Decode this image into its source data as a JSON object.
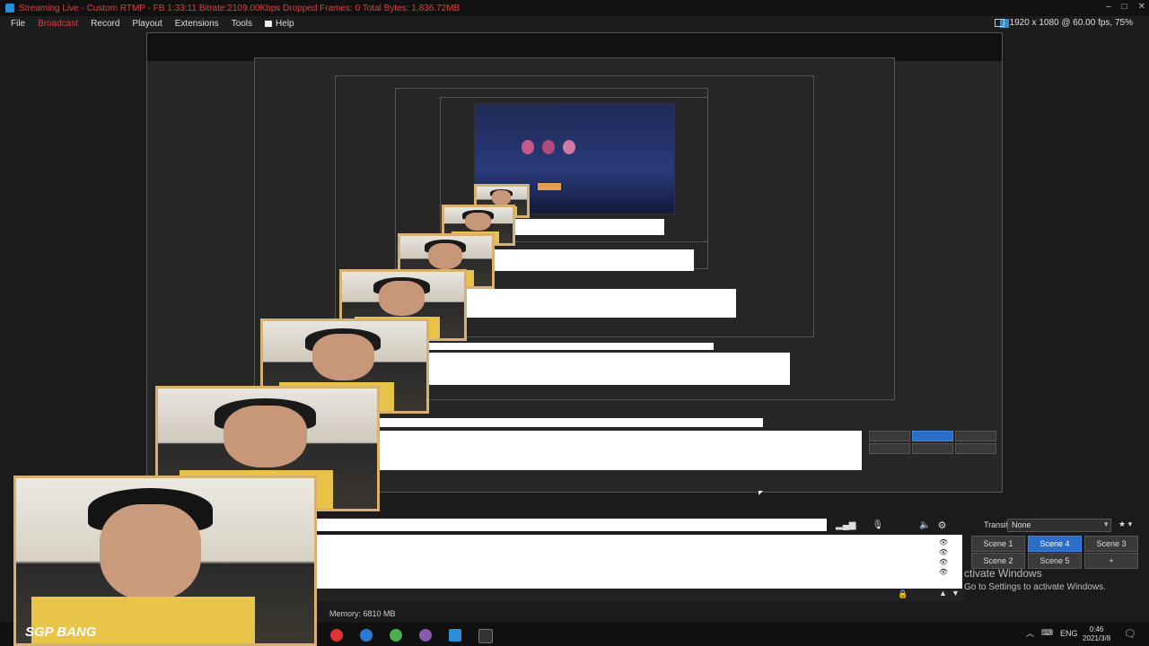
{
  "window": {
    "title": "Streaming Live - Custom RTMP - FB 1:33:11  Bitrate:2109.00Kbps  Dropped Frames: 0  Total Bytes: 1,836.72MB",
    "resolution": "1920 x 1080 @ 60.00 fps, 75%"
  },
  "menu": {
    "file": "File",
    "broadcast": "Broadcast",
    "record": "Record",
    "playout": "Playout",
    "extensions": "Extensions",
    "tools": "Tools",
    "help": "Help"
  },
  "transition": {
    "label": "Transition",
    "value": "None"
  },
  "scenes": [
    {
      "label": "Scene 1",
      "active": false
    },
    {
      "label": "Scene 4",
      "active": true
    },
    {
      "label": "Scene 3",
      "active": false
    },
    {
      "label": "Scene 2",
      "active": false
    },
    {
      "label": "Scene 5",
      "active": false
    },
    {
      "label": "+",
      "active": false
    }
  ],
  "activation": {
    "title": "ctivate Windows",
    "subtitle": "Go to Settings to activate Windows."
  },
  "status": {
    "memory": "Memory:  6810 MB"
  },
  "taskbar": {
    "language": "ENG",
    "time": "0:46",
    "date": "2021/3/8"
  },
  "overlay": {
    "logo": "SGP BANG"
  },
  "colors": {
    "accent": "#2a6ec8",
    "live_text": "#e23b3b",
    "cam_frame": "#d8b070"
  }
}
